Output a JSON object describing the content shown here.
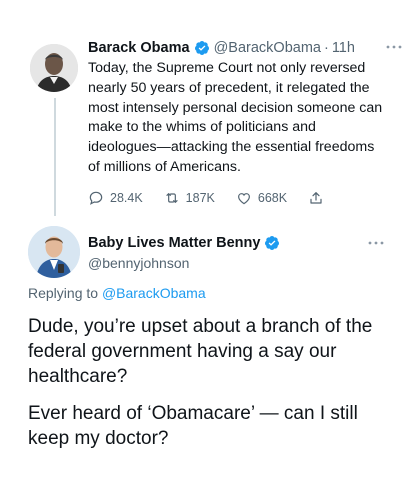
{
  "tweet": {
    "author_name": "Barack Obama",
    "author_handle": "@BarackObama",
    "separator": "·",
    "time": "11h",
    "text": "Today, the Supreme Court not only reversed nearly 50 years of precedent, it relegated the most intensely personal decision someone can make to the whims of politicians and ideologues—attacking the essential freedoms of millions of Americans.",
    "replies": "28.4K",
    "retweets": "187K",
    "likes": "668K"
  },
  "reply": {
    "author_name": "Baby Lives Matter Benny",
    "author_handle": "@bennyjohnson",
    "replying_prefix": "Replying to",
    "replying_handle": "@BarackObama",
    "paragraph1": "Dude, you’re upset about a branch of the federal government having a say our healthcare?",
    "paragraph2": "Ever heard of ‘Obamacare’ — can I still keep my doctor?"
  },
  "colors": {
    "verified_blue": "#1d9bf0",
    "secondary_text": "#536471",
    "primary_text": "#0f1419"
  },
  "icons": [
    "verified-badge-icon",
    "more-options-icon",
    "reply-icon",
    "retweet-icon",
    "like-icon",
    "share-icon"
  ]
}
